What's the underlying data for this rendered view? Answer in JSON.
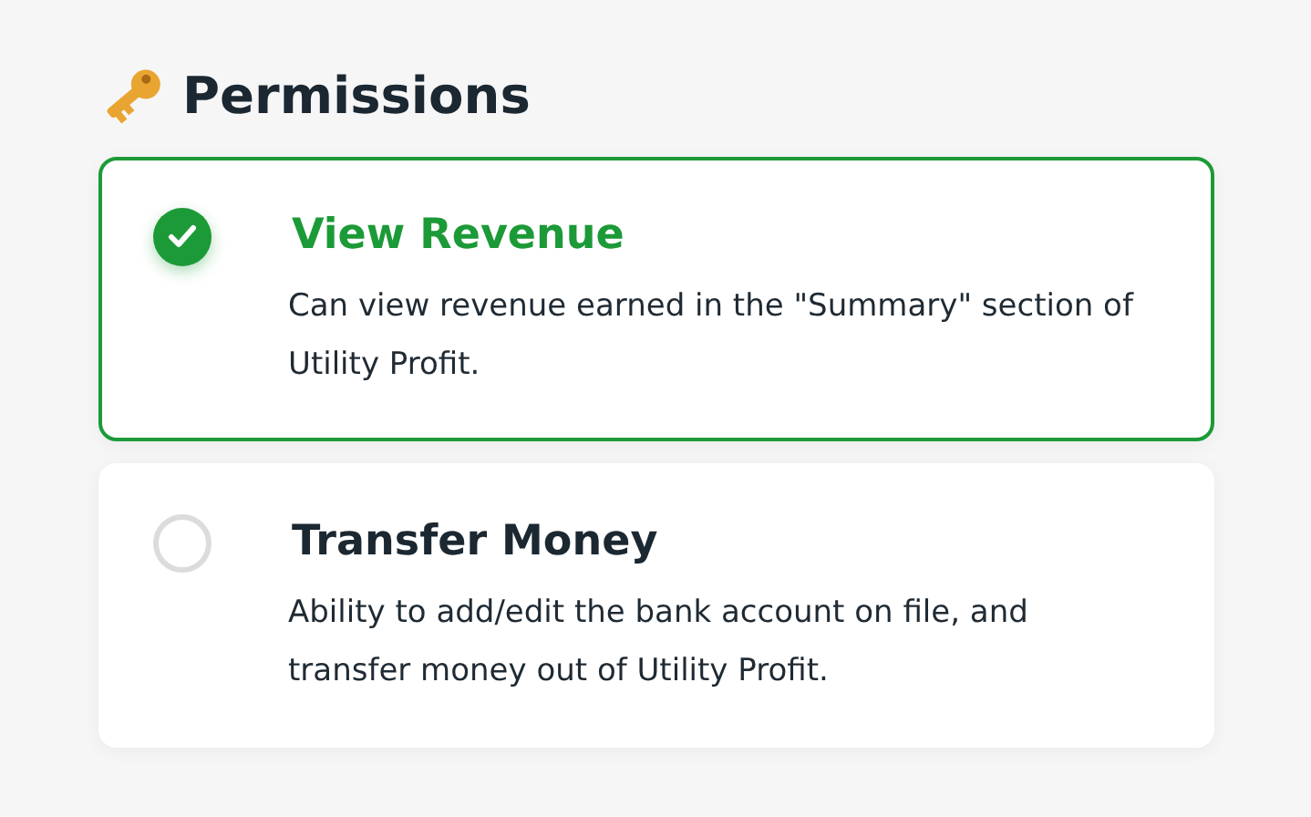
{
  "heading": "Permissions",
  "permissions": [
    {
      "title": "View Revenue",
      "description": "Can view revenue earned in the \"Summary\" section of Utility Profit.",
      "selected": true
    },
    {
      "title": "Transfer Money",
      "description": "Ability to add/edit the bank account on file, and transfer money out of Utility Profit.",
      "selected": false
    }
  ]
}
